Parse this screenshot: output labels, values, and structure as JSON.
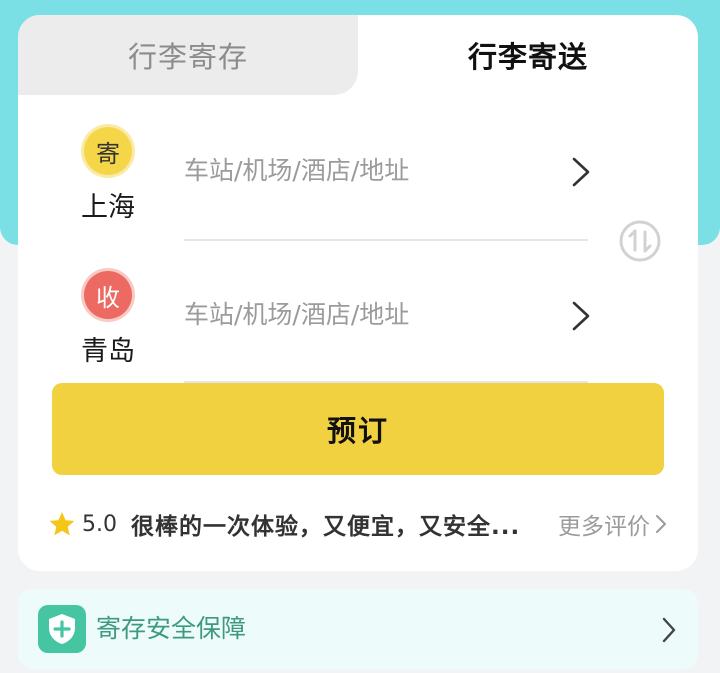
{
  "tabs": [
    {
      "label": "行李寄存",
      "active": false
    },
    {
      "label": "行李寄送",
      "active": true
    }
  ],
  "route": {
    "send": {
      "badge": "寄",
      "city": "上海",
      "placeholder": "车站/机场/酒店/地址"
    },
    "receive": {
      "badge": "收",
      "city": "青岛",
      "placeholder": "车站/机场/酒店/地址"
    }
  },
  "book_button": "预订",
  "review": {
    "rating": "5.0",
    "text": "很棒的一次体验，又便宜，又安全...",
    "more_label": "更多评价"
  },
  "guarantee": {
    "label": "寄存安全保障"
  },
  "colors": {
    "top_band": "#7be0e6",
    "send_badge": "#f5d648",
    "receive_badge": "#ec6a62",
    "book_button": "#f2d141",
    "guarantee_icon": "#45c5a2",
    "guarantee_text": "#3e9a7e"
  },
  "icons": [
    "chevron-right-icon",
    "swap-icon",
    "star-icon",
    "shield-plus-icon"
  ]
}
